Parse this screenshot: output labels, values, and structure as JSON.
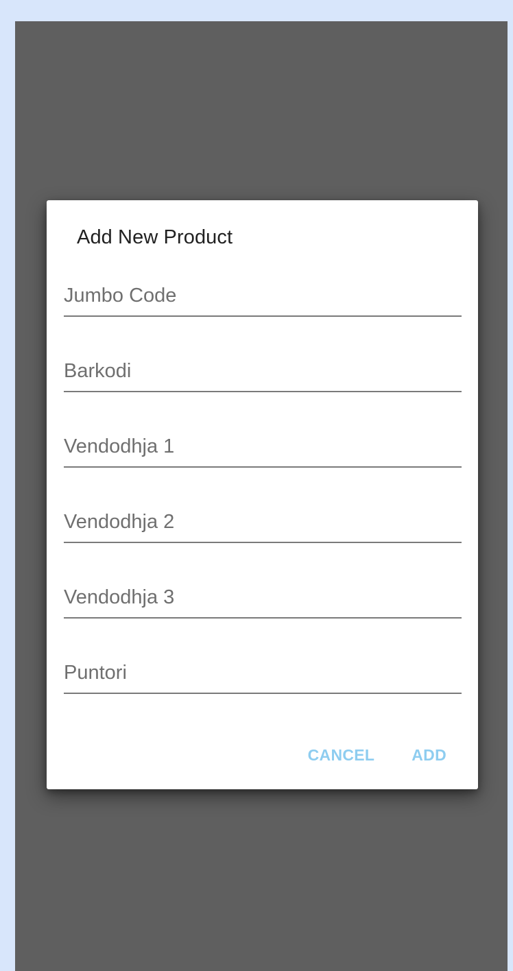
{
  "dialog": {
    "title": "Add New Product",
    "fields": [
      {
        "placeholder": "Jumbo Code",
        "value": ""
      },
      {
        "placeholder": "Barkodi",
        "value": ""
      },
      {
        "placeholder": "Vendodhja 1",
        "value": ""
      },
      {
        "placeholder": "Vendodhja 2",
        "value": ""
      },
      {
        "placeholder": "Vendodhja 3",
        "value": ""
      },
      {
        "placeholder": "Puntori",
        "value": ""
      }
    ],
    "cancel_label": "CANCEL",
    "add_label": "ADD"
  },
  "colors": {
    "backdrop": "#5f5f5f",
    "page_background": "#d8e6fb",
    "dialog_background": "#ffffff",
    "button_accent": "#8ecdf0",
    "underline": "#7a7a7a"
  }
}
